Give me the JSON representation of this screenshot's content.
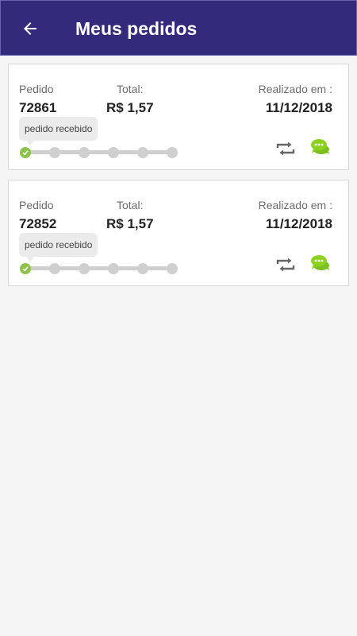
{
  "appbar": {
    "title": "Meus pedidos",
    "back_icon": "arrow-left-icon",
    "background": "#332a7c"
  },
  "labels": {
    "order": "Pedido",
    "total": "Total:",
    "date": "Realizado em :"
  },
  "orders": [
    {
      "number": "72861",
      "total": "R$ 1,57",
      "date": "11/12/2018",
      "status": "pedido recebido",
      "steps_total": 6,
      "steps_done": 1
    },
    {
      "number": "72852",
      "total": "R$ 1,57",
      "date": "11/12/2018",
      "status": "pedido recebido",
      "steps_total": 6,
      "steps_done": 1
    }
  ],
  "icons": {
    "reorder": "repeat-icon",
    "chat": "chat-bubbles-icon"
  },
  "colors": {
    "accent_green": "#8bc34a",
    "step_pending": "#cfcfcf"
  }
}
